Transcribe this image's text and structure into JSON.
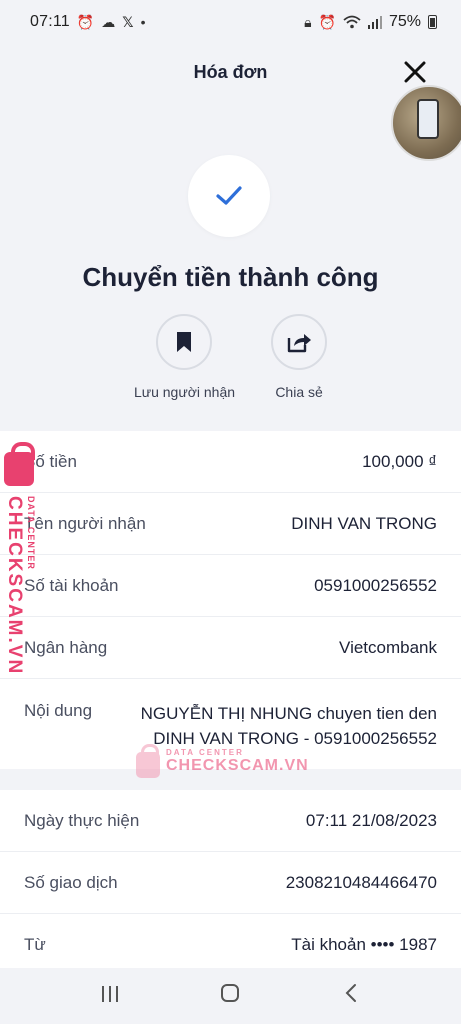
{
  "status_bar": {
    "time": "07:11",
    "battery": "75%",
    "left_icons": [
      "alarm-icon",
      "cloud-icon",
      "x-icon",
      "dot-icon"
    ],
    "right_icons": [
      "lock-icon",
      "alarm-icon",
      "wifi-icon",
      "signal-icon",
      "battery-icon"
    ]
  },
  "header": {
    "title": "Hóa đơn",
    "close_icon": "×"
  },
  "success": {
    "title": "Chuyển tiền thành công"
  },
  "actions": [
    {
      "label": "Lưu người nhận",
      "icon": "bookmark-icon"
    },
    {
      "label": "Chia sẻ",
      "icon": "share-icon"
    }
  ],
  "details": [
    {
      "label": "Số tiền",
      "value": "100,000 ₫"
    },
    {
      "label": "Tên người nhận",
      "value": "DINH VAN TRONG"
    },
    {
      "label": "Số tài khoản",
      "value": "0591000256552"
    },
    {
      "label": "Ngân hàng",
      "value": "Vietcombank"
    },
    {
      "label": "Nội dung",
      "value": "NGUYỄN THỊ NHUNG chuyen tien den DINH VAN TRONG - 0591000256552"
    }
  ],
  "details2": [
    {
      "label": "Ngày thực hiện",
      "value": "07:11 21/08/2023"
    },
    {
      "label": "Số giao dịch",
      "value": "2308210484466470"
    },
    {
      "label": "Từ",
      "value": "Tài khoản •••• 1987"
    }
  ],
  "watermark": {
    "brand": "CHECKSCAM.VN",
    "sub": "DATA CENTER"
  },
  "colors": {
    "accent": "#2e6fd9",
    "watermark": "#e8416f",
    "background": "#f2f3f7"
  }
}
